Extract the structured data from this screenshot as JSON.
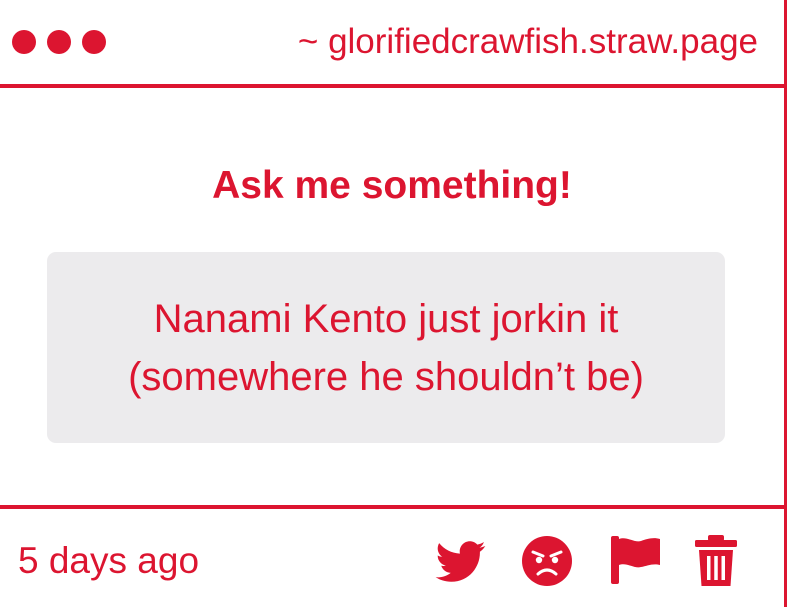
{
  "header": {
    "site": "~ glorifiedcrawfish.straw.page"
  },
  "main": {
    "prompt_title": "Ask me something!",
    "question_lines": [
      "Nanami Kento just jorkin it",
      "(somewhere he shouldn’t be)"
    ]
  },
  "footer": {
    "timestamp": "5 days ago",
    "actions": [
      "twitter-icon",
      "angry-face-icon",
      "flag-icon",
      "trash-icon"
    ]
  },
  "colors": {
    "accent": "#dc1530",
    "question_bg": "#ecebed"
  }
}
